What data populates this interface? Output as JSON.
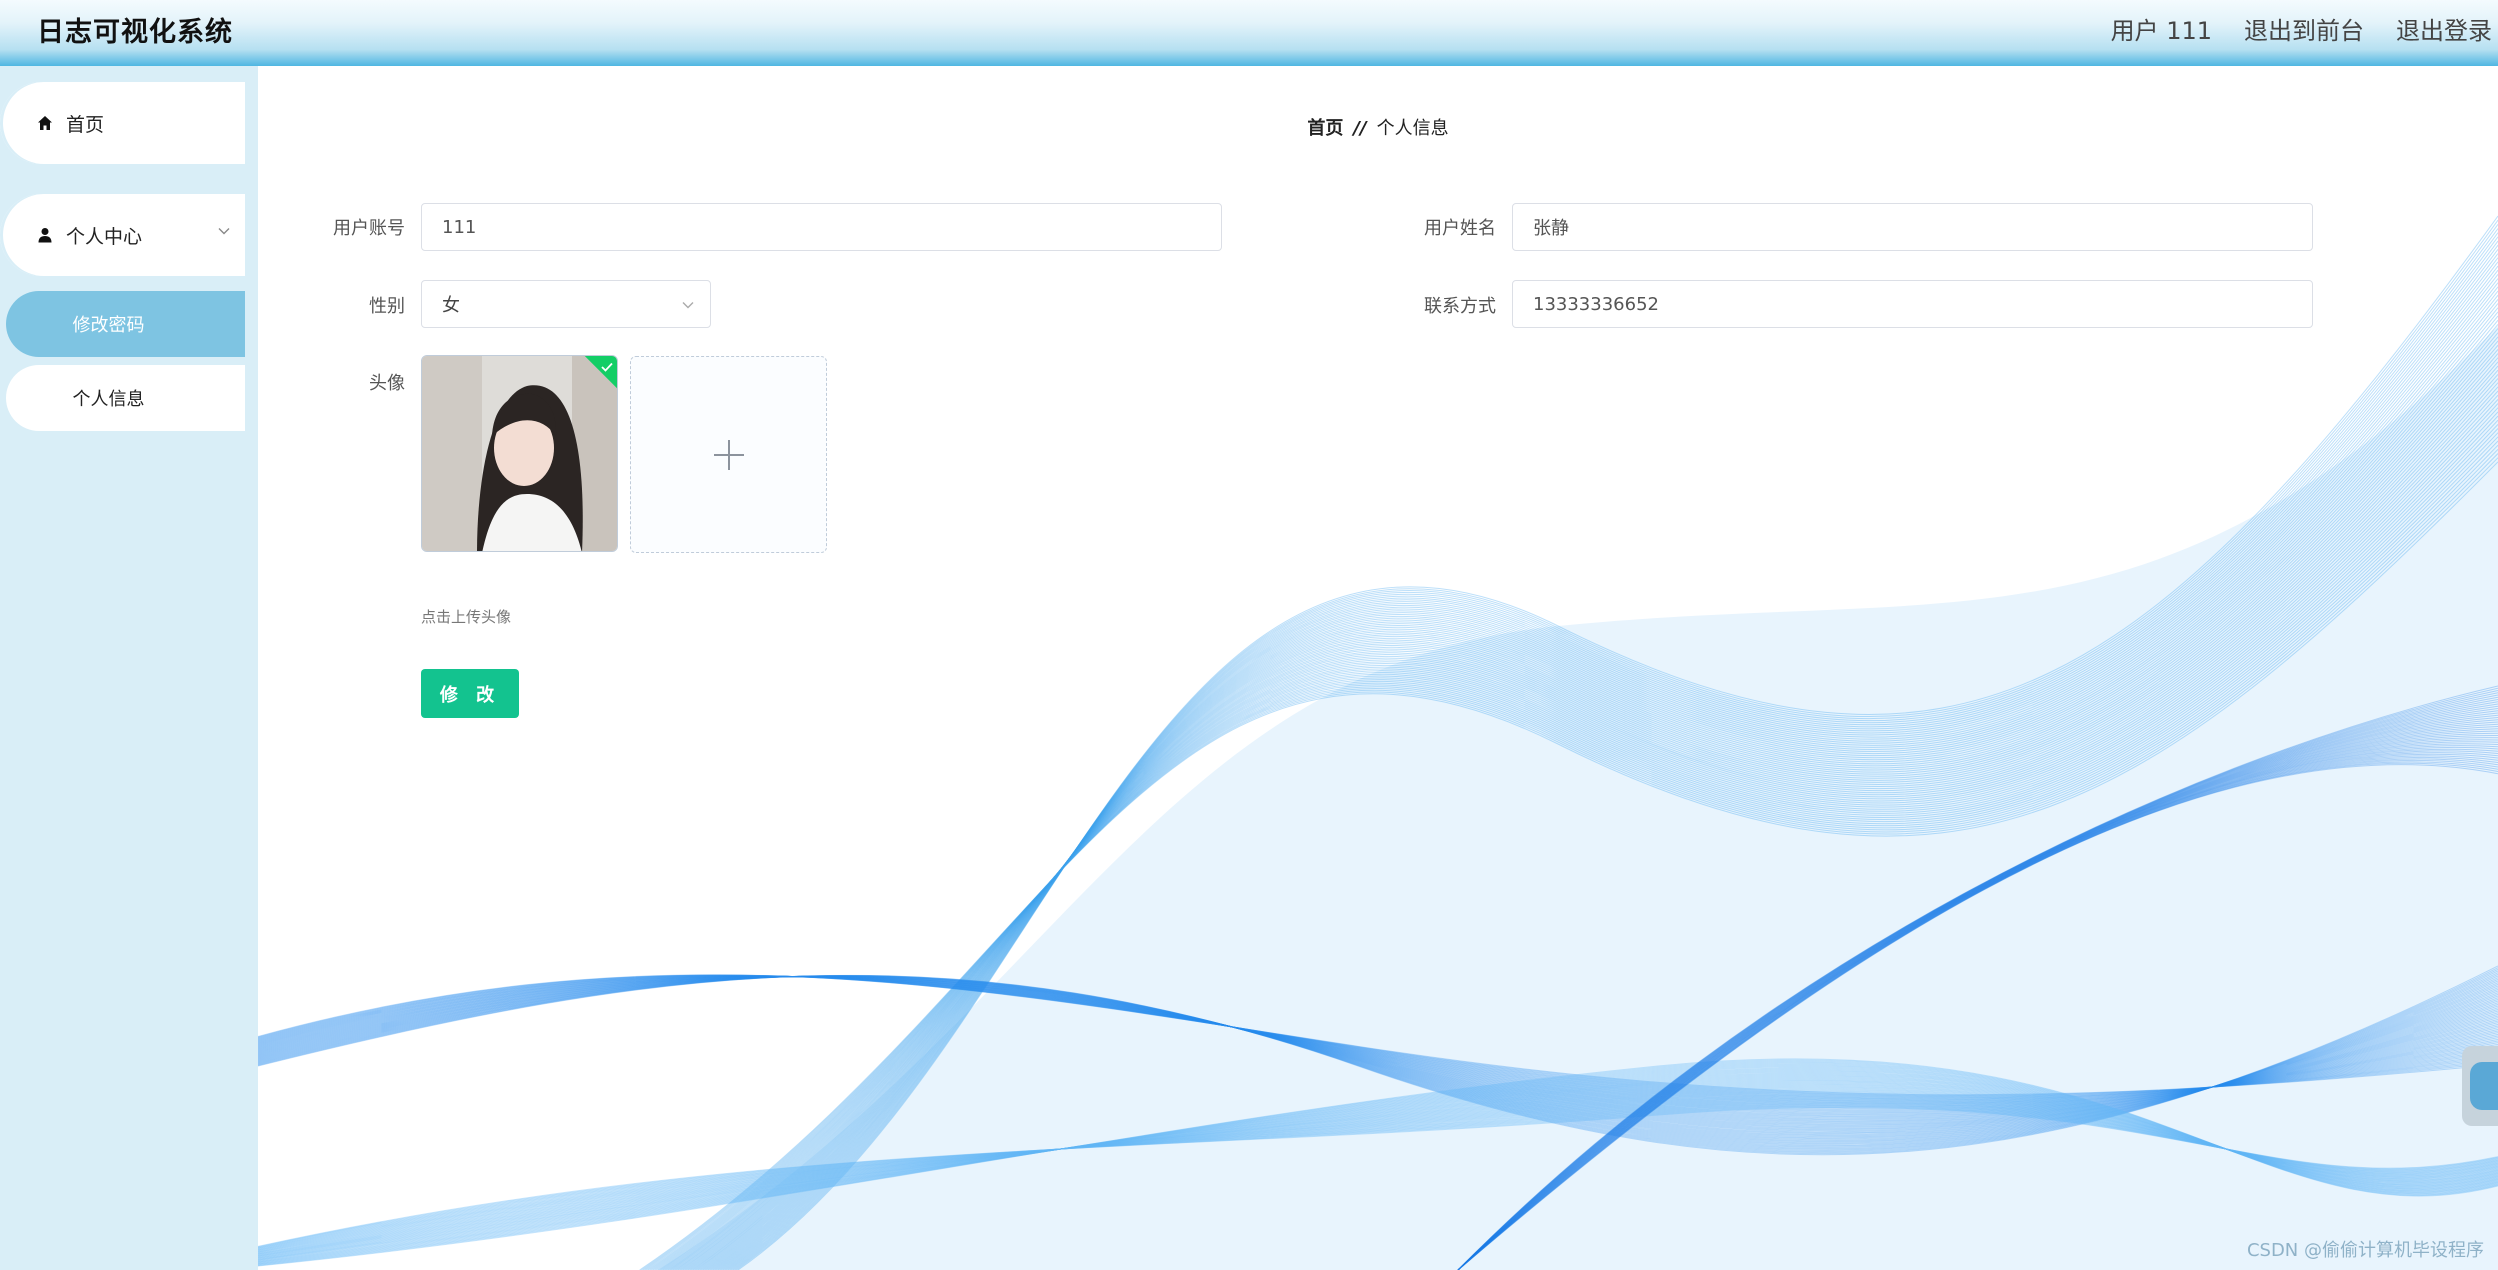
{
  "header": {
    "app_title": "日志可视化系统",
    "user_label": "用户 111",
    "back_to_front": "退出到前台",
    "logout": "退出登录"
  },
  "sidebar": {
    "home": "首页",
    "personal_center": "个人中心",
    "sub_items": [
      "修改密码",
      "个人信息"
    ]
  },
  "breadcrumb": {
    "home": "首页",
    "separator": "//",
    "current": "个人信息"
  },
  "form": {
    "account_label": "用户账号",
    "account_value": "111",
    "name_label": "用户姓名",
    "name_value": "张静",
    "gender_label": "性别",
    "gender_value": "女",
    "phone_label": "联系方式",
    "phone_value": "13333336652",
    "avatar_label": "头像",
    "upload_tip": "点击上传头像",
    "submit_label": "修 改"
  },
  "watermark": "CSDN @偷偷计算机毕设程序",
  "colors": {
    "accent": "#7ec4e2",
    "header_gradient_end": "#4fb6e2",
    "submit": "#13c38f",
    "sidebar_bg": "#d9eef7"
  }
}
